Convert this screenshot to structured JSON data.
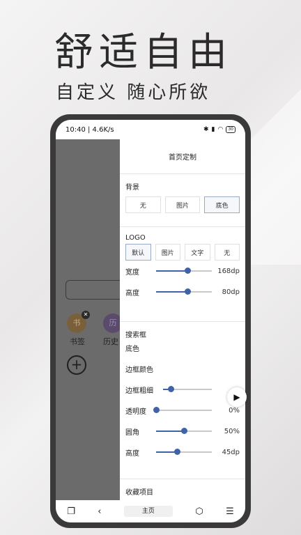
{
  "promo": {
    "headline": "舒适自由",
    "subline": "自定义 随心所欲"
  },
  "statusbar": {
    "time": "10:40 | 4.6K/s",
    "battery": "30"
  },
  "home": {
    "bookmark_icon_text": "书",
    "bookmark_label": "书签",
    "history_icon_text": "历",
    "history_label": "历史",
    "add_symbol": "+"
  },
  "panel": {
    "title": "首页定制",
    "background": {
      "label": "背景",
      "options": [
        "无",
        "图片",
        "底色"
      ],
      "selected": "底色"
    },
    "logo": {
      "label": "LOGO",
      "options": [
        "默认",
        "图片",
        "文字",
        "无"
      ],
      "selected": "默认",
      "width_label": "宽度",
      "width_value": "168dp",
      "width_level": 0.56,
      "height_label": "高度",
      "height_value": "80dp",
      "height_level": 0.56
    },
    "searchbox": {
      "label": "搜索框",
      "bg_color_label": "底色",
      "border_color_label": "边框颜色",
      "border_width_label": "边框粗细",
      "border_width_level": 0.15,
      "opacity_label": "透明度",
      "opacity_value": "0%",
      "opacity_level": 0.0,
      "radius_label": "圆角",
      "radius_value": "50%",
      "radius_level": 0.5,
      "height_label": "高度",
      "height_value": "45dp",
      "height_level": 0.38
    },
    "favorites_label": "收藏项目"
  },
  "navbar": {
    "home_label": "主页"
  },
  "colors": {
    "accent": "#3f63a6",
    "side_pane": "#6b6b6b"
  }
}
